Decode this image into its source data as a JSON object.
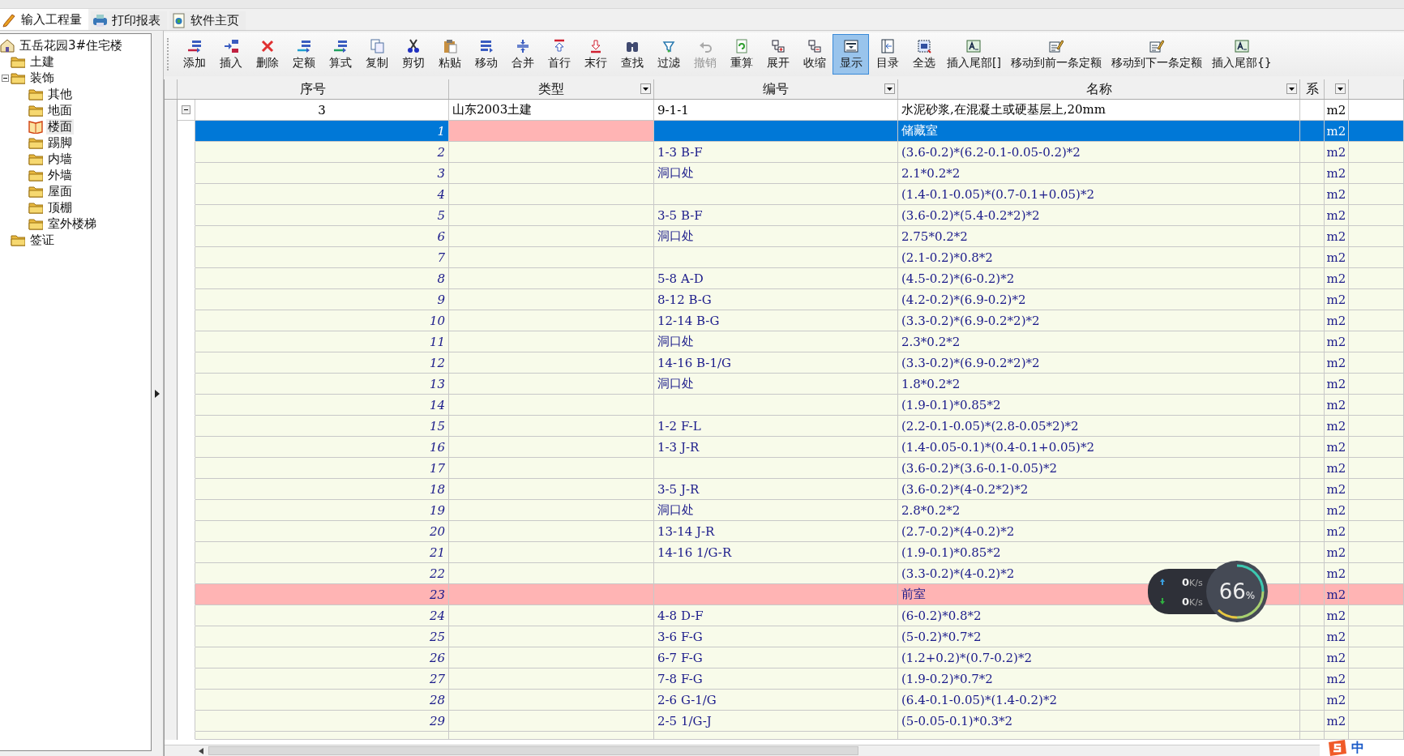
{
  "tabs": [
    {
      "label": "输入工程量",
      "selected": true
    },
    {
      "label": "打印报表",
      "selected": false
    },
    {
      "label": "软件主页",
      "selected": false
    }
  ],
  "tree": {
    "label": "五岳花园3#住宅楼",
    "selected": false,
    "children": [
      {
        "label": "土建",
        "selected": false
      },
      {
        "label": "装饰",
        "selected": false,
        "expanded": true,
        "children": [
          {
            "label": "其他",
            "selected": false
          },
          {
            "label": "地面",
            "selected": false
          },
          {
            "label": "楼面",
            "selected": true
          },
          {
            "label": "踢脚",
            "selected": false
          },
          {
            "label": "内墙",
            "selected": false
          },
          {
            "label": "外墙",
            "selected": false
          },
          {
            "label": "屋面",
            "selected": false
          },
          {
            "label": "顶棚",
            "selected": false
          },
          {
            "label": "室外楼梯",
            "selected": false
          }
        ]
      },
      {
        "label": "签证",
        "selected": false
      }
    ]
  },
  "toolbar": [
    {
      "label": "添加",
      "selected": false,
      "disabled": false
    },
    {
      "label": "插入",
      "selected": false,
      "disabled": false
    },
    {
      "label": "删除",
      "selected": false,
      "disabled": false
    },
    {
      "label": "定额",
      "selected": false,
      "disabled": false
    },
    {
      "label": "算式",
      "selected": false,
      "disabled": false
    },
    {
      "label": "复制",
      "selected": false,
      "disabled": false
    },
    {
      "label": "剪切",
      "selected": false,
      "disabled": false
    },
    {
      "label": "粘贴",
      "selected": false,
      "disabled": false
    },
    {
      "label": "移动",
      "selected": false,
      "disabled": false
    },
    {
      "label": "合并",
      "selected": false,
      "disabled": false
    },
    {
      "label": "首行",
      "selected": false,
      "disabled": false
    },
    {
      "label": "末行",
      "selected": false,
      "disabled": false
    },
    {
      "label": "查找",
      "selected": false,
      "disabled": false
    },
    {
      "label": "过滤",
      "selected": false,
      "disabled": false
    },
    {
      "label": "撤销",
      "selected": false,
      "disabled": true
    },
    {
      "label": "重算",
      "selected": false,
      "disabled": false
    },
    {
      "label": "展开",
      "selected": false,
      "disabled": false
    },
    {
      "label": "收缩",
      "selected": false,
      "disabled": false
    },
    {
      "label": "显示",
      "selected": true,
      "disabled": false
    },
    {
      "label": "目录",
      "selected": false,
      "disabled": false
    },
    {
      "label": "全选",
      "selected": false,
      "disabled": false
    },
    {
      "label": "插入尾部[]",
      "selected": false,
      "disabled": false
    },
    {
      "label": "移动到前一条定额",
      "selected": false,
      "disabled": false
    },
    {
      "label": "移动到下一条定额",
      "selected": false,
      "disabled": false
    },
    {
      "label": "插入尾部{}",
      "selected": false,
      "disabled": false
    }
  ],
  "table": {
    "columns": [
      {
        "label": "序号",
        "dropdown": false
      },
      {
        "label": "类型",
        "dropdown": true
      },
      {
        "label": "编号",
        "dropdown": true
      },
      {
        "label": "名称",
        "dropdown": true
      },
      {
        "label": "系",
        "dropdown": false
      },
      {
        "dropdown": true
      }
    ],
    "parent": {
      "seq": "3",
      "type": "山东2003土建",
      "code": "9-1-1",
      "name": "水泥砂浆,在混凝土或硬基层上,20mm",
      "unit": "m2",
      "expanded": true
    },
    "rows": [
      {
        "seq": "1",
        "kind": "heading",
        "selected": true,
        "code": "",
        "name": "储藏室",
        "unit": "m2"
      },
      {
        "seq": "2",
        "kind": "formula",
        "selected": false,
        "code": "1-3 B-F",
        "name": "(3.6-0.2)*(6.2-0.1-0.05-0.2)*2",
        "unit": "m2"
      },
      {
        "seq": "3",
        "kind": "formula",
        "selected": false,
        "code": "洞口处",
        "name": "2.1*0.2*2",
        "unit": "m2"
      },
      {
        "seq": "4",
        "kind": "formula",
        "selected": false,
        "code": "",
        "name": "(1.4-0.1-0.05)*(0.7-0.1+0.05)*2",
        "unit": "m2"
      },
      {
        "seq": "5",
        "kind": "formula",
        "selected": false,
        "code": "3-5 B-F",
        "name": "(3.6-0.2)*(5.4-0.2*2)*2",
        "unit": "m2"
      },
      {
        "seq": "6",
        "kind": "formula",
        "selected": false,
        "code": "洞口处",
        "name": "2.75*0.2*2",
        "unit": "m2"
      },
      {
        "seq": "7",
        "kind": "formula",
        "selected": false,
        "code": "",
        "name": "(2.1-0.2)*0.8*2",
        "unit": "m2"
      },
      {
        "seq": "8",
        "kind": "formula",
        "selected": false,
        "code": "5-8 A-D",
        "name": "(4.5-0.2)*(6-0.2)*2",
        "unit": "m2"
      },
      {
        "seq": "9",
        "kind": "formula",
        "selected": false,
        "code": "8-12 B-G",
        "name": "(4.2-0.2)*(6.9-0.2)*2",
        "unit": "m2"
      },
      {
        "seq": "10",
        "kind": "formula",
        "selected": false,
        "code": "12-14 B-G",
        "name": "(3.3-0.2)*(6.9-0.2*2)*2",
        "unit": "m2"
      },
      {
        "seq": "11",
        "kind": "formula",
        "selected": false,
        "code": "洞口处",
        "name": "2.3*0.2*2",
        "unit": "m2"
      },
      {
        "seq": "12",
        "kind": "formula",
        "selected": false,
        "code": "14-16 B-1/G",
        "name": "(3.3-0.2)*(6.9-0.2*2)*2",
        "unit": "m2"
      },
      {
        "seq": "13",
        "kind": "formula",
        "selected": false,
        "code": "洞口处",
        "name": "1.8*0.2*2",
        "unit": "m2"
      },
      {
        "seq": "14",
        "kind": "formula",
        "selected": false,
        "code": "",
        "name": "(1.9-0.1)*0.85*2",
        "unit": "m2"
      },
      {
        "seq": "15",
        "kind": "formula",
        "selected": false,
        "code": "1-2 F-L",
        "name": "(2.2-0.1-0.05)*(2.8-0.05*2)*2",
        "unit": "m2"
      },
      {
        "seq": "16",
        "kind": "formula",
        "selected": false,
        "code": "1-3 J-R",
        "name": "(1.4-0.05-0.1)*(0.4-0.1+0.05)*2",
        "unit": "m2"
      },
      {
        "seq": "17",
        "kind": "formula",
        "selected": false,
        "code": "",
        "name": "(3.6-0.2)*(3.6-0.1-0.05)*2",
        "unit": "m2"
      },
      {
        "seq": "18",
        "kind": "formula",
        "selected": false,
        "code": "3-5 J-R",
        "name": "(3.6-0.2)*(4-0.2*2)*2",
        "unit": "m2"
      },
      {
        "seq": "19",
        "kind": "formula",
        "selected": false,
        "code": "洞口处",
        "name": "2.8*0.2*2",
        "unit": "m2"
      },
      {
        "seq": "20",
        "kind": "formula",
        "selected": false,
        "code": "13-14 J-R",
        "name": "(2.7-0.2)*(4-0.2)*2",
        "unit": "m2"
      },
      {
        "seq": "21",
        "kind": "formula",
        "selected": false,
        "code": "14-16 1/G-R",
        "name": "(1.9-0.1)*0.85*2",
        "unit": "m2"
      },
      {
        "seq": "22",
        "kind": "formula",
        "selected": false,
        "code": "",
        "name": "(3.3-0.2)*(4-0.2)*2",
        "unit": "m2"
      },
      {
        "seq": "23",
        "kind": "heading",
        "selected": false,
        "code": "",
        "name": "前室",
        "unit": "m2"
      },
      {
        "seq": "24",
        "kind": "formula",
        "selected": false,
        "code": "4-8 D-F",
        "name": "(6-0.2)*0.8*2",
        "unit": "m2"
      },
      {
        "seq": "25",
        "kind": "formula",
        "selected": false,
        "code": "3-6 F-G",
        "name": "(5-0.2)*0.7*2",
        "unit": "m2"
      },
      {
        "seq": "26",
        "kind": "formula",
        "selected": false,
        "code": "6-7 F-G",
        "name": "(1.2+0.2)*(0.7-0.2)*2",
        "unit": "m2"
      },
      {
        "seq": "27",
        "kind": "formula",
        "selected": false,
        "code": "7-8 F-G",
        "name": "(1.9-0.2)*0.7*2",
        "unit": "m2"
      },
      {
        "seq": "28",
        "kind": "formula",
        "selected": false,
        "code": "2-6 G-1/G",
        "name": "(6.4-0.1-0.05)*(1.4-0.2)*2",
        "unit": "m2"
      },
      {
        "seq": "29",
        "kind": "formula",
        "selected": false,
        "code": "2-5 1/G-J",
        "name": "(5-0.05-0.1)*0.3*2",
        "unit": "m2"
      }
    ]
  },
  "speed_widget": {
    "upload": {
      "value": "0",
      "unit": "K/s"
    },
    "download": {
      "value": "0",
      "unit": "K/s"
    },
    "percent": "66",
    "percent_sign": "%"
  },
  "ime": {
    "mode": "中"
  }
}
